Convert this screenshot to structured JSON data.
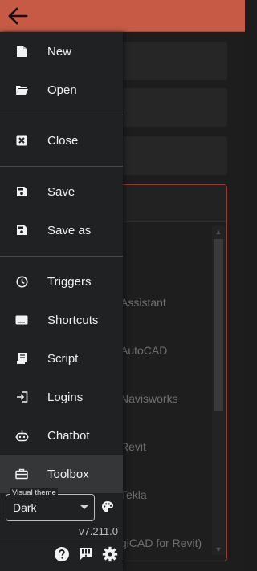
{
  "appbar": {
    "back_icon": "arrow-left-icon",
    "color": "#c75a44"
  },
  "menu": [
    {
      "label": "New",
      "icon": "file-icon"
    },
    {
      "label": "Open",
      "icon": "folder-open-icon"
    },
    {
      "label": "Close",
      "icon": "close-box-icon"
    },
    {
      "label": "Save",
      "icon": "save-icon"
    },
    {
      "label": "Save as",
      "icon": "save-as-icon"
    },
    {
      "label": "Triggers",
      "icon": "clock-icon"
    },
    {
      "label": "Shortcuts",
      "icon": "keyboard-icon"
    },
    {
      "label": "Script",
      "icon": "script-icon"
    },
    {
      "label": "Logins",
      "icon": "login-icon"
    },
    {
      "label": "Chatbot",
      "icon": "robot-icon"
    },
    {
      "label": "Toolbox",
      "icon": "toolbox-icon"
    }
  ],
  "active_item": "Toolbox",
  "theme": {
    "legend": "Visual theme",
    "value": "Dark"
  },
  "version": "v7.211.0",
  "footer_icons": [
    "help-icon",
    "feedback-icon",
    "settings-icon"
  ],
  "background": {
    "items": [
      "Assistant",
      "AutoCAD",
      "Navisworks",
      "Revit",
      "Tekla",
      "giCAD for Revit)"
    ]
  }
}
